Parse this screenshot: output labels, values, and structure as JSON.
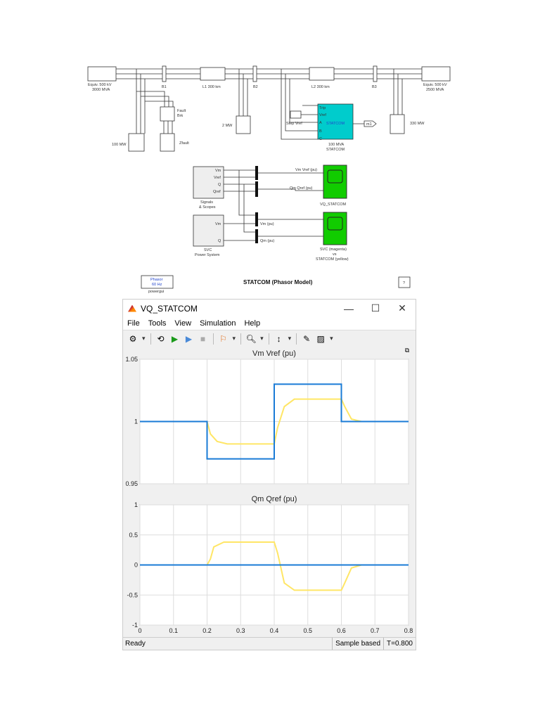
{
  "diagram": {
    "src_left": [
      "Equiv. 500 kV",
      "3000 MVA"
    ],
    "src_right": [
      "Equiv. 500 kV",
      "2500 MVA"
    ],
    "b1": "B1",
    "b2": "B2",
    "b3": "B3",
    "l1": "L1 300 km",
    "l2": "L2 300 km",
    "fault": [
      "Fault",
      "Brk"
    ],
    "zfault": "Zfault",
    "load100": "100 MW",
    "load2": "2 MW",
    "load330": "330 MW",
    "statcom": "STATCOM",
    "statcom_ports": [
      "Trip",
      "Vref",
      "A",
      "B",
      "C"
    ],
    "statcom_label": [
      "100 MVA",
      "STATCOM"
    ],
    "step": "Step Vref",
    "goto": "m1",
    "sig_ports": [
      "Vm",
      "Vref",
      "Q",
      "Qref"
    ],
    "sig_label": [
      "Signals",
      "& Scopes"
    ],
    "svc_ports": [
      "Vm",
      "Q"
    ],
    "svc_label": [
      "SVC",
      "Power System"
    ],
    "wires": [
      "Vm Vref (pu)",
      "Qm Qref (pu)",
      "Vm (pu)",
      "Qm (pu)"
    ],
    "scope1": "VQ_STATCOM",
    "scope2": [
      "SVC (magenta)",
      "vs",
      "STATCOM (yellow)"
    ],
    "powergui": [
      "Phasor",
      "60 Hz"
    ],
    "powergui_label": "powergui",
    "title": "STATCOM (Phasor Model)",
    "help": "?"
  },
  "window": {
    "title": "VQ_STATCOM",
    "controls": [
      "—",
      "☐",
      "✕"
    ],
    "menu": [
      "File",
      "Tools",
      "View",
      "Simulation",
      "Help"
    ],
    "status": {
      "left": "Ready",
      "mode": "Sample based",
      "time": "T=0.800"
    }
  },
  "colors": {
    "blue": "#1a7bd6",
    "yellow": "#ffe666",
    "cyan": "#00cccc",
    "green": "#11cc00"
  },
  "chart_data": [
    {
      "type": "line",
      "title": "Vm Vref (pu)",
      "ylim": [
        0.95,
        1.05
      ],
      "xlim": [
        0,
        0.8
      ],
      "yticks": [
        0.95,
        1,
        1.05
      ],
      "ytick_labels": [
        "0.95",
        "1",
        "1.05"
      ],
      "xticks": [
        0,
        0.1,
        0.2,
        0.3,
        0.4,
        0.5,
        0.6,
        0.7,
        0.8
      ],
      "xtick_labels": [],
      "grid": true,
      "series": [
        {
          "name": "Vm",
          "color": "#ffe666",
          "x": [
            0,
            0.2,
            0.21,
            0.23,
            0.26,
            0.4,
            0.41,
            0.43,
            0.46,
            0.6,
            0.61,
            0.63,
            0.66,
            0.8
          ],
          "y": [
            1,
            1,
            0.99,
            0.984,
            0.982,
            0.982,
            0.995,
            1.012,
            1.018,
            1.018,
            1.012,
            1.002,
            1,
            1
          ]
        },
        {
          "name": "Vref",
          "color": "#1a7bd6",
          "x": [
            0,
            0.2,
            0.2,
            0.4,
            0.4,
            0.6,
            0.6,
            0.8
          ],
          "y": [
            1,
            1,
            0.97,
            0.97,
            1.03,
            1.03,
            1,
            1
          ]
        }
      ]
    },
    {
      "type": "line",
      "title": "Qm Qref (pu)",
      "ylim": [
        -1,
        1
      ],
      "xlim": [
        0,
        0.8
      ],
      "yticks": [
        -1,
        -0.5,
        0,
        0.5,
        1
      ],
      "ytick_labels": [
        "-1",
        "-0.5",
        "0",
        "0.5",
        "1"
      ],
      "xticks": [
        0,
        0.1,
        0.2,
        0.3,
        0.4,
        0.5,
        0.6,
        0.7,
        0.8
      ],
      "xtick_labels": [
        "0",
        "0.1",
        "0.2",
        "0.3",
        "0.4",
        "0.5",
        "0.6",
        "0.7",
        "0.8"
      ],
      "grid": true,
      "series": [
        {
          "name": "Qm",
          "color": "#ffe666",
          "x": [
            0,
            0.2,
            0.21,
            0.22,
            0.25,
            0.4,
            0.41,
            0.43,
            0.46,
            0.6,
            0.61,
            0.63,
            0.66,
            0.8
          ],
          "y": [
            0,
            0,
            0.1,
            0.3,
            0.38,
            0.38,
            0.2,
            -0.3,
            -0.42,
            -0.42,
            -0.3,
            -0.05,
            0,
            0
          ]
        },
        {
          "name": "Qref",
          "color": "#1a7bd6",
          "x": [
            0,
            0.8
          ],
          "y": [
            0,
            0
          ]
        }
      ]
    }
  ]
}
